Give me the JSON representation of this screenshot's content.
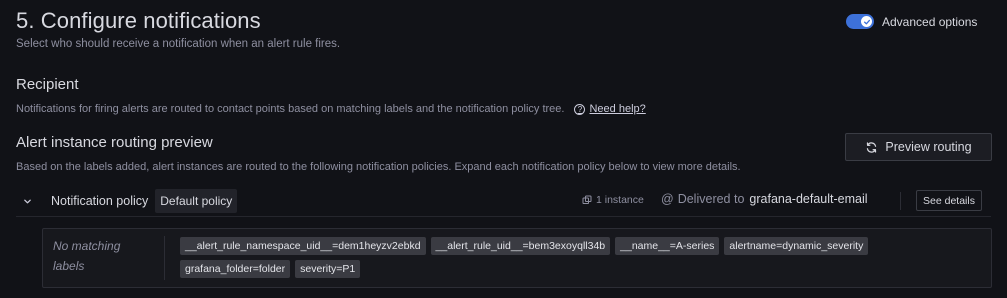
{
  "header": {
    "title": "5. Configure notifications",
    "description": "Select who should receive a notification when an alert rule fires."
  },
  "advanced_options": {
    "label": "Advanced options",
    "enabled": true,
    "accent_color": "#3d71d9"
  },
  "recipient": {
    "title": "Recipient",
    "description": "Notifications for firing alerts are routed to contact points based on matching labels and the notification policy tree.",
    "help_link": "Need help?"
  },
  "routing_preview": {
    "title": "Alert instance routing preview",
    "description": "Based on the labels added, alert instances are routed to the following notification policies. Expand each notification policy below to view more details.",
    "preview_button": "Preview routing"
  },
  "policy": {
    "label": "Notification policy",
    "name": "Default policy",
    "instances": "1 instance",
    "delivered_prefix": "Delivered to",
    "contact_point": "grafana-default-email",
    "see_details": "See details"
  },
  "matching": {
    "no_match_text": "No matching labels",
    "labels": [
      "__alert_rule_namespace_uid__=dem1heyzv2ebkd",
      "__alert_rule_uid__=bem3exoyqll34b",
      "__name__=A-series",
      "alertname=dynamic_severity",
      "grafana_folder=folder",
      "severity=P1"
    ]
  },
  "icons": {
    "toggle_check": "check-icon",
    "help": "question-circle-icon",
    "preview": "sync-icon",
    "chevron": "chevron-down-icon",
    "instances": "layers-icon",
    "delivered": "at-icon"
  }
}
